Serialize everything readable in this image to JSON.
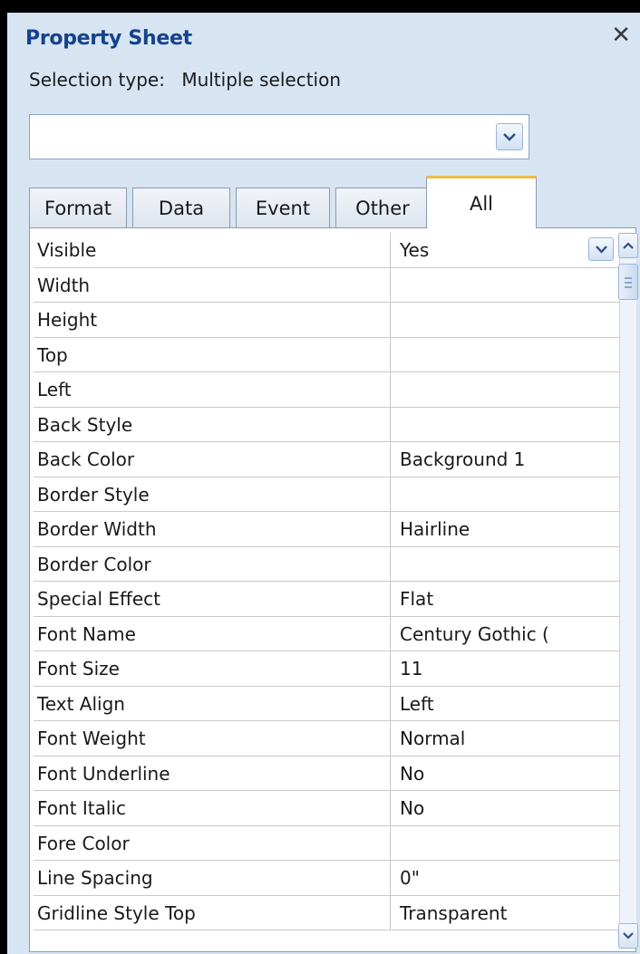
{
  "panel": {
    "title": "Property Sheet",
    "close_label": "✕",
    "selection_label": "Selection type:",
    "selection_value": "Multiple selection",
    "combo_value": ""
  },
  "tabs": [
    {
      "label": "Format",
      "active": false
    },
    {
      "label": "Data",
      "active": false
    },
    {
      "label": "Event",
      "active": false
    },
    {
      "label": "Other",
      "active": false
    },
    {
      "label": "All",
      "active": true
    }
  ],
  "properties": [
    {
      "name": "Visible",
      "value": "Yes"
    },
    {
      "name": "Width",
      "value": ""
    },
    {
      "name": "Height",
      "value": ""
    },
    {
      "name": "Top",
      "value": ""
    },
    {
      "name": "Left",
      "value": ""
    },
    {
      "name": "Back Style",
      "value": ""
    },
    {
      "name": "Back Color",
      "value": "Background 1"
    },
    {
      "name": "Border Style",
      "value": ""
    },
    {
      "name": "Border Width",
      "value": "Hairline"
    },
    {
      "name": "Border Color",
      "value": ""
    },
    {
      "name": "Special Effect",
      "value": "Flat"
    },
    {
      "name": "Font Name",
      "value": "Century Gothic ("
    },
    {
      "name": "Font Size",
      "value": "11"
    },
    {
      "name": "Text Align",
      "value": "Left"
    },
    {
      "name": "Font Weight",
      "value": "Normal"
    },
    {
      "name": "Font Underline",
      "value": "No"
    },
    {
      "name": "Font Italic",
      "value": "No"
    },
    {
      "name": "Fore Color",
      "value": ""
    },
    {
      "name": "Line Spacing",
      "value": "0\""
    },
    {
      "name": "Gridline Style Top",
      "value": "Transparent"
    }
  ],
  "icons": {
    "close": "close-icon",
    "combo_dropdown": "chevron-down-icon",
    "scroll_up": "chevron-up-icon",
    "scroll_down": "chevron-down-icon"
  }
}
